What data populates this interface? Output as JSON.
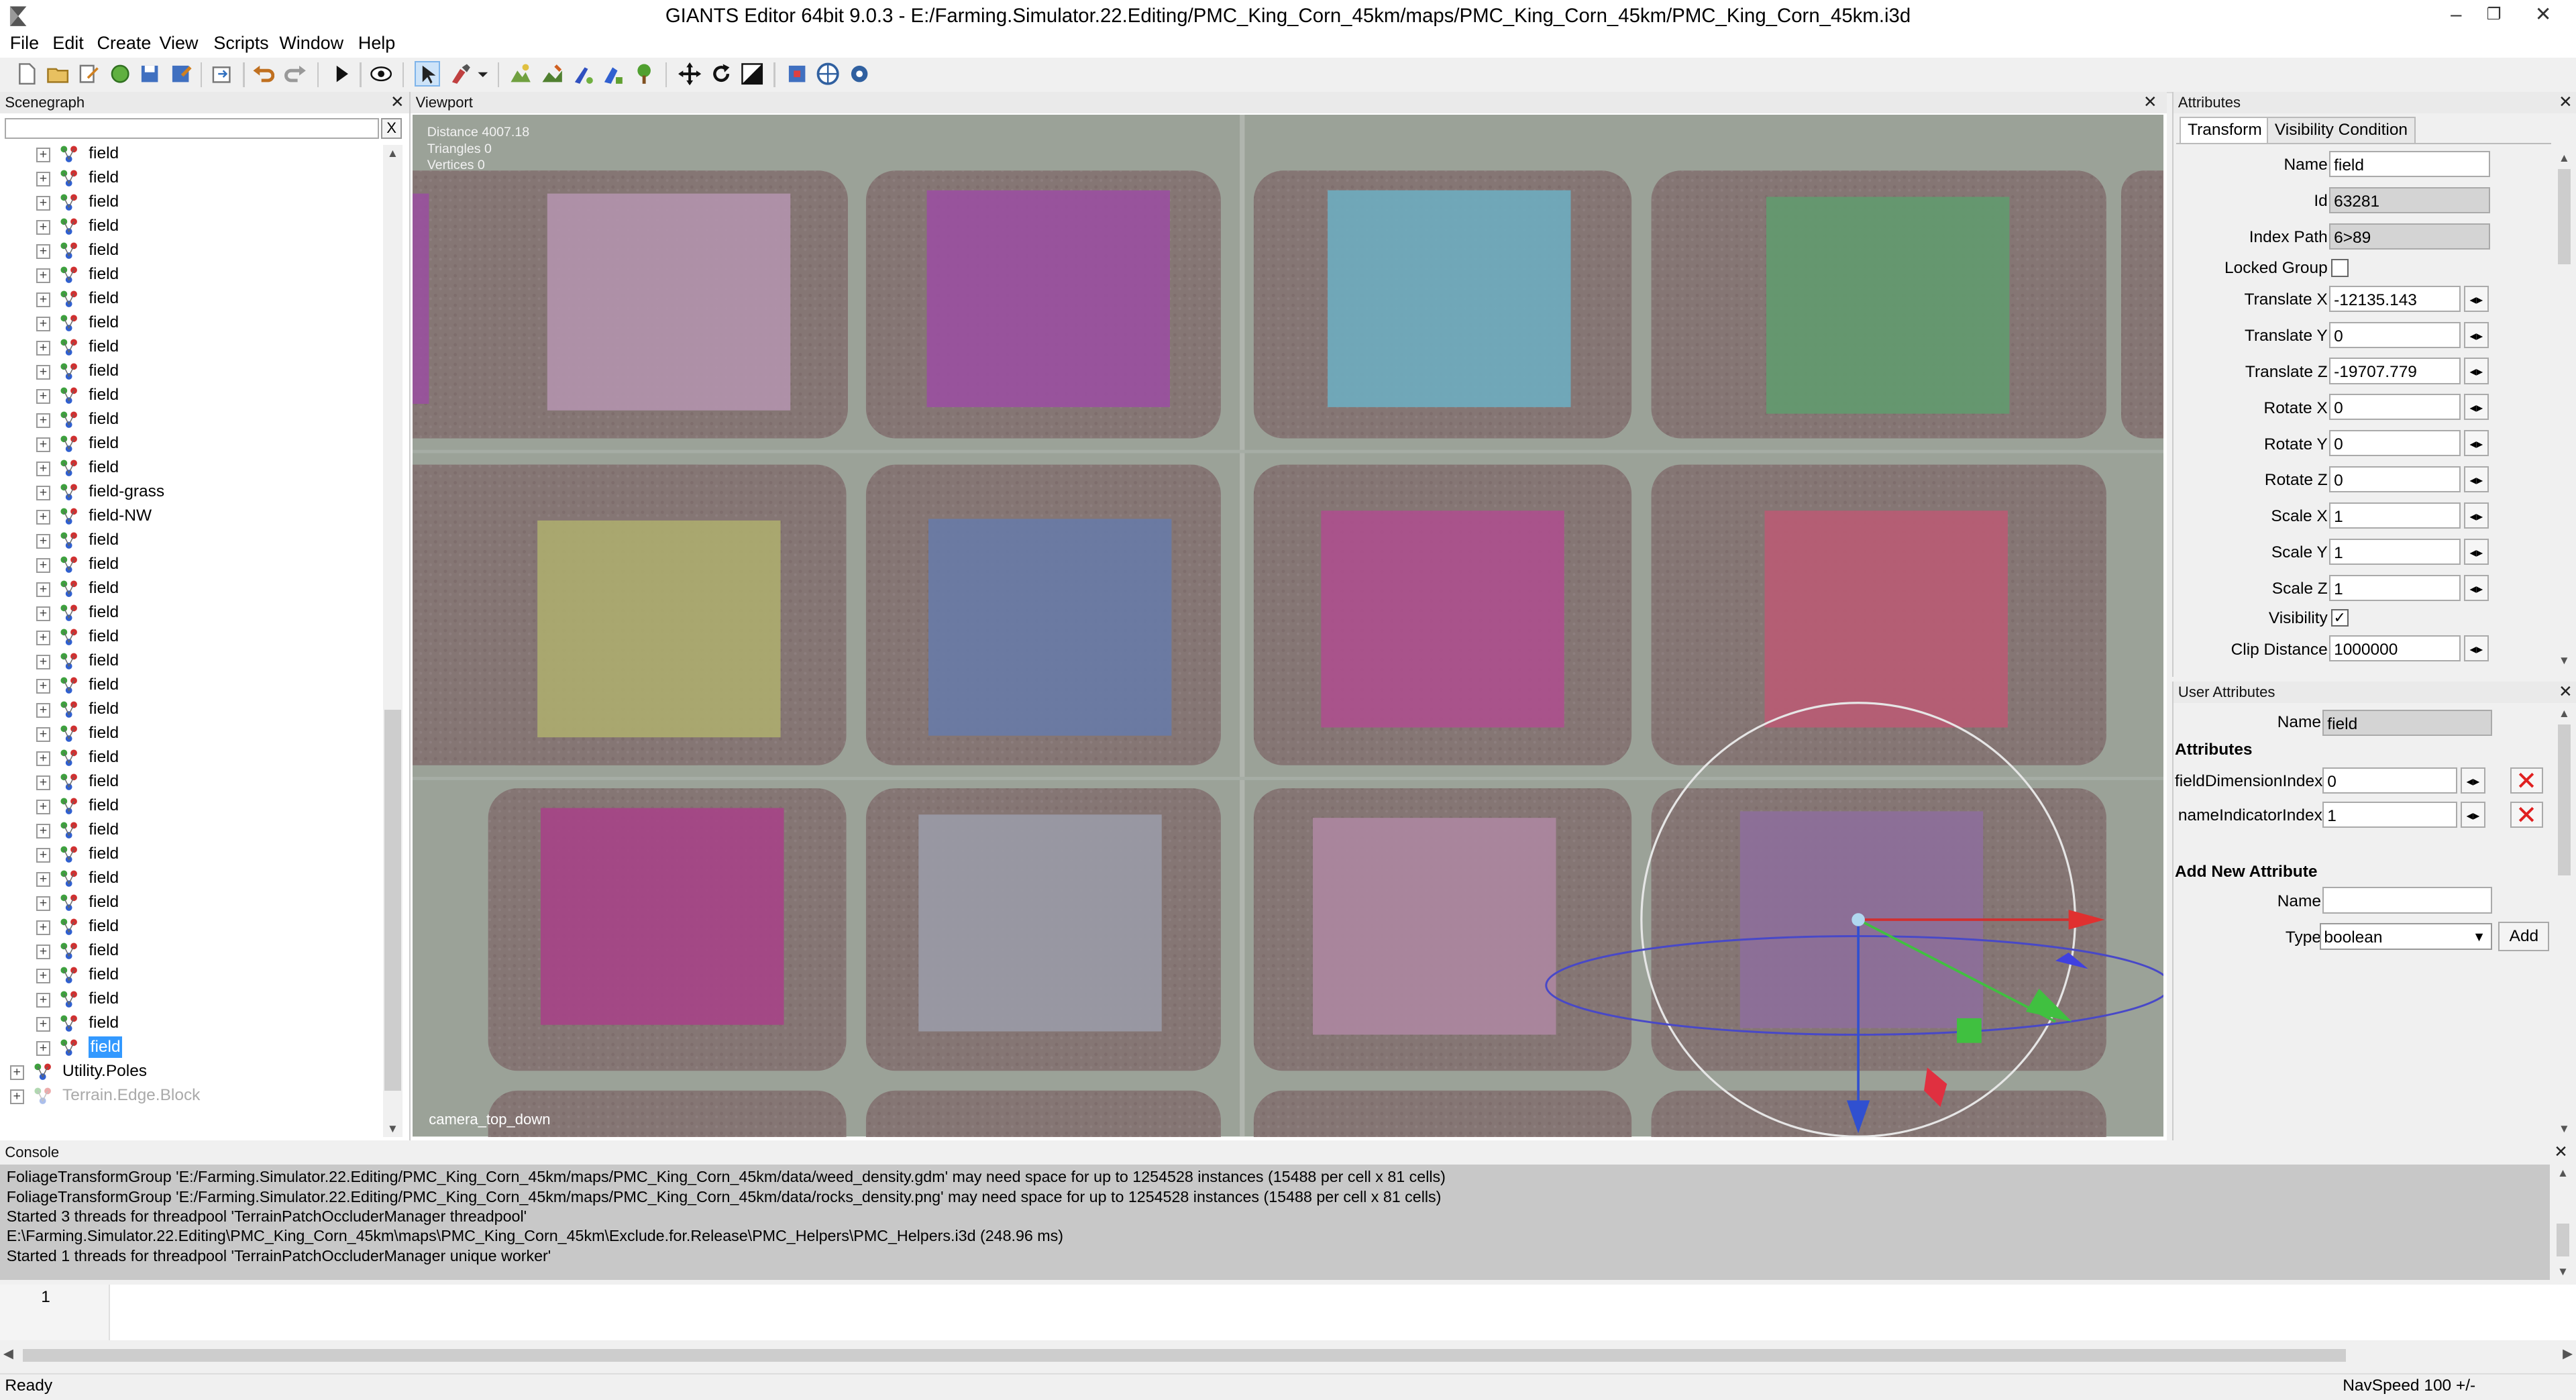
{
  "window": {
    "title": "GIANTS Editor 64bit 9.0.3 - E:/Farming.Simulator.22.Editing/PMC_King_Corn_45km/maps/PMC_King_Corn_45km/PMC_King_Corn_45km.i3d",
    "minimize": "–",
    "maximize": "❐",
    "close": "✕"
  },
  "menu": [
    "File",
    "Edit",
    "Create",
    "View",
    "Scripts",
    "Window",
    "Help"
  ],
  "scenegraph": {
    "title": "Scenegraph",
    "close": "✕",
    "search_clear": "X",
    "nodes": [
      {
        "label": "field"
      },
      {
        "label": "field"
      },
      {
        "label": "field"
      },
      {
        "label": "field"
      },
      {
        "label": "field"
      },
      {
        "label": "field"
      },
      {
        "label": "field"
      },
      {
        "label": "field"
      },
      {
        "label": "field"
      },
      {
        "label": "field"
      },
      {
        "label": "field"
      },
      {
        "label": "field"
      },
      {
        "label": "field"
      },
      {
        "label": "field"
      },
      {
        "label": "field-grass"
      },
      {
        "label": "field-NW"
      },
      {
        "label": "field"
      },
      {
        "label": "field"
      },
      {
        "label": "field"
      },
      {
        "label": "field"
      },
      {
        "label": "field"
      },
      {
        "label": "field"
      },
      {
        "label": "field"
      },
      {
        "label": "field"
      },
      {
        "label": "field"
      },
      {
        "label": "field"
      },
      {
        "label": "field"
      },
      {
        "label": "field"
      },
      {
        "label": "field"
      },
      {
        "label": "field"
      },
      {
        "label": "field"
      },
      {
        "label": "field"
      },
      {
        "label": "field"
      },
      {
        "label": "field"
      },
      {
        "label": "field"
      },
      {
        "label": "field"
      },
      {
        "label": "field"
      },
      {
        "label": "field",
        "selected": true
      },
      {
        "label": "Utility.Poles",
        "top": true
      },
      {
        "label": "Terrain.Edge.Block",
        "top": true,
        "dim": true
      }
    ]
  },
  "viewport": {
    "title": "Viewport",
    "close": "✕",
    "stats": [
      "Distance 4007.18",
      "Triangles 0",
      "Vertices 0"
    ],
    "camera": "camera_top_down"
  },
  "attributes": {
    "title": "Attributes",
    "close": "✕",
    "tabs": [
      "Transform",
      "Visibility Condition"
    ],
    "labels": {
      "name": "Name",
      "id": "Id",
      "index_path": "Index Path",
      "locked_group": "Locked Group",
      "tx": "Translate X",
      "ty": "Translate Y",
      "tz": "Translate Z",
      "rx": "Rotate X",
      "ry": "Rotate Y",
      "rz": "Rotate Z",
      "sx": "Scale X",
      "sy": "Scale Y",
      "sz": "Scale Z",
      "visibility": "Visibility",
      "clip": "Clip Distance"
    },
    "values": {
      "name": "field",
      "id": "63281",
      "index_path": "6>89",
      "tx": "-12135.143",
      "ty": "0",
      "tz": "-19707.779",
      "rx": "0",
      "ry": "0",
      "rz": "0",
      "sx": "1",
      "sy": "1",
      "sz": "1",
      "clip": "1000000",
      "locked_group": false,
      "visibility": true
    }
  },
  "user_attributes": {
    "title": "User Attributes",
    "close": "✕",
    "name_label": "Name",
    "name_value": "field",
    "section": "Attributes",
    "items": [
      {
        "label": "fieldDimensionIndex",
        "value": "0"
      },
      {
        "label": "nameIndicatorIndex",
        "value": "1"
      }
    ],
    "add_section": "Add New Attribute",
    "new_name_label": "Name",
    "new_name_value": "",
    "type_label": "Type",
    "type_value": "boolean",
    "add_button": "Add"
  },
  "console": {
    "title": "Console",
    "close": "✕",
    "lines": [
      "FoliageTransformGroup 'E:/Farming.Simulator.22.Editing/PMC_King_Corn_45km/maps/PMC_King_Corn_45km/data/weed_density.gdm' may need space for up to 1254528 instances (15488 per cell x 81 cells)",
      "FoliageTransformGroup 'E:/Farming.Simulator.22.Editing/PMC_King_Corn_45km/maps/PMC_King_Corn_45km/data/rocks_density.png' may need space for up to 1254528 instances (15488 per cell x 81 cells)",
      "Started 3 threads for threadpool 'TerrainPatchOccluderManager threadpool'",
      "E:\\Farming.Simulator.22.Editing\\PMC_King_Corn_45km\\maps\\PMC_King_Corn_45km\\Exclude.for.Release\\PMC_Helpers\\PMC_Helpers.i3d (248.96 ms)",
      "Started 1 threads for threadpool 'TerrainPatchOccluderManager unique worker'"
    ],
    "input_line": "1"
  },
  "status": {
    "left": "Ready",
    "right": "NavSpeed 100 +/-"
  },
  "colors": {
    "selection": "#3399ff",
    "field_patches": [
      "#c8a0c0",
      "#a848b0",
      "#70c0d8",
      "#60a870",
      "#c0c070",
      "#6880b8",
      "#c04898",
      "#d05878",
      "#b83890",
      "#a8aab8",
      "#c090b0",
      "#9870a8"
    ]
  }
}
